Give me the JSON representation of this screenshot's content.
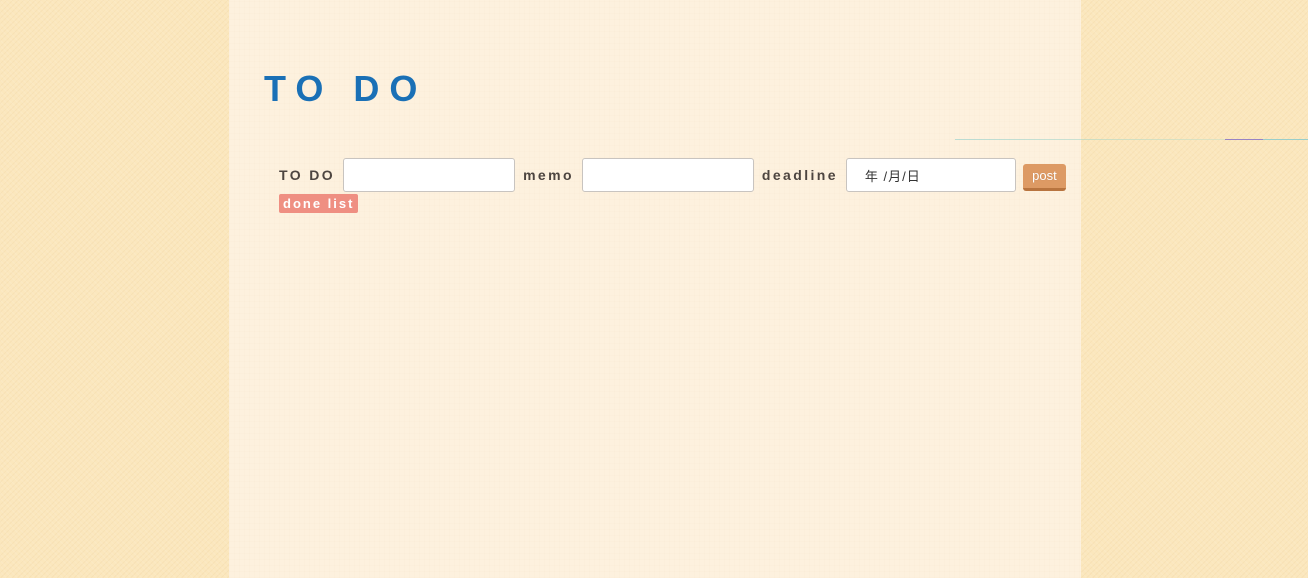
{
  "app": {
    "title": "TO DO"
  },
  "form": {
    "todo_label": "TO DO",
    "todo_value": "",
    "memo_label": "memo",
    "memo_value": "",
    "deadline_label": "deadline",
    "deadline_placeholder": "年 /月/日",
    "post_label": "post"
  },
  "done_list": {
    "label": "done list"
  },
  "colors": {
    "background": "#fbe7bd",
    "paper": "#fdf1de",
    "title": "#1a70b6",
    "post_button": "#dd9a64",
    "done_list_button": "#ef8f82"
  }
}
